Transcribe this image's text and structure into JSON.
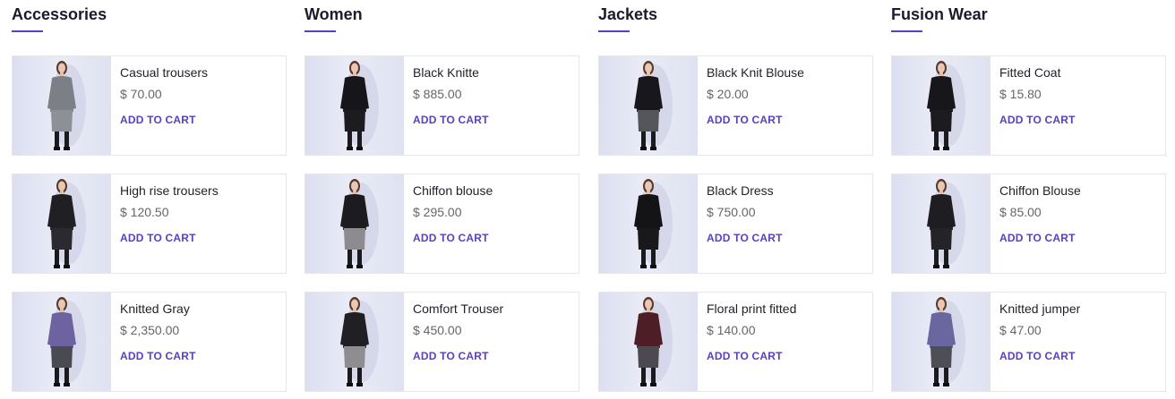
{
  "columns": [
    {
      "title": "Accessories",
      "products": [
        {
          "name": "Casual trousers",
          "price": "$ 70.00",
          "cta": "ADD TO CART",
          "image": "woman-gray-coat-photo",
          "top": "#7d7f86",
          "bottom": "#8e9097"
        },
        {
          "name": "High rise trousers",
          "price": "$ 120.50",
          "cta": "ADD TO CART",
          "image": "woman-black-dress-photo",
          "top": "#1f1f24",
          "bottom": "#2a2a30"
        },
        {
          "name": "Knitted Gray",
          "price": "$ 2,350.00",
          "cta": "ADD TO CART",
          "image": "woman-purple-sweater-photo",
          "top": "#6e62a1",
          "bottom": "#4a4a52"
        }
      ]
    },
    {
      "title": "Women",
      "products": [
        {
          "name": "Black Knitte",
          "price": "$ 885.00",
          "cta": "ADD TO CART",
          "image": "woman-black-knit-dress-photo",
          "top": "#16161a",
          "bottom": "#1b1b20"
        },
        {
          "name": "Chiffon blouse",
          "price": "$ 295.00",
          "cta": "ADD TO CART",
          "image": "woman-leather-jacket-photo",
          "top": "#1c1c20",
          "bottom": "#8d8b8f"
        },
        {
          "name": "Comfort Trouser",
          "price": "$ 450.00",
          "cta": "ADD TO CART",
          "image": "woman-jacket-gray-trousers-photo",
          "top": "#202024",
          "bottom": "#8f8d92"
        }
      ]
    },
    {
      "title": "Jackets",
      "products": [
        {
          "name": "Black Knit Blouse",
          "price": "$ 20.00",
          "cta": "ADD TO CART",
          "image": "woman-black-blouse-plaid-skirt-photo",
          "top": "#18181c",
          "bottom": "#55555c"
        },
        {
          "name": "Black Dress",
          "price": "$ 750.00",
          "cta": "ADD TO CART",
          "image": "woman-black-dress-arms-crossed-photo",
          "top": "#141417",
          "bottom": "#19191c"
        },
        {
          "name": "Floral print fitted",
          "price": "$ 140.00",
          "cta": "ADD TO CART",
          "image": "woman-burgundy-top-photo",
          "top": "#4e1e26",
          "bottom": "#4a4a50"
        }
      ]
    },
    {
      "title": "Fusion Wear",
      "products": [
        {
          "name": "Fitted Coat",
          "price": "$ 15.80",
          "cta": "ADD TO CART",
          "image": "woman-black-coat-photo",
          "top": "#17171b",
          "bottom": "#1c1c20"
        },
        {
          "name": "Chiffon Blouse",
          "price": "$ 85.00",
          "cta": "ADD TO CART",
          "image": "woman-black-outfit-photo",
          "top": "#1d1d22",
          "bottom": "#232328"
        },
        {
          "name": "Knitted jumper",
          "price": "$ 47.00",
          "cta": "ADD TO CART",
          "image": "woman-purple-jumper-back-photo",
          "top": "#6a66a0",
          "bottom": "#4e4e56"
        }
      ]
    }
  ],
  "colors": {
    "accent": "#5a3fc0",
    "title": "#1b1b2b",
    "price": "#666666",
    "border": "#e6e6ea"
  }
}
